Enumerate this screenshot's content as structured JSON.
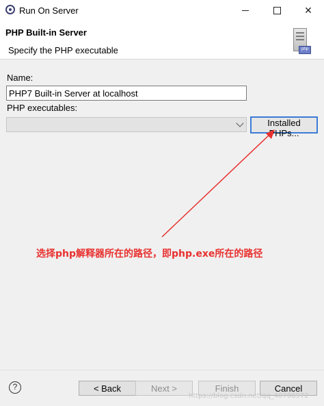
{
  "window": {
    "title": "Run On Server"
  },
  "header": {
    "title": "PHP Built-in Server",
    "subtitle": "Specify the PHP executable",
    "icon_badge": "php"
  },
  "form": {
    "name_label": "Name:",
    "name_value": "PHP7 Built-in Server at localhost",
    "exe_label": "PHP executables:",
    "exe_value": "",
    "installed_button": "Installed PHPs..."
  },
  "annotation": {
    "text": "选择php解释器所在的路径，即php.exe所在的路径",
    "color": "#e8312f"
  },
  "footer": {
    "help": "?",
    "back": "< Back",
    "next": "Next >",
    "finish": "Finish",
    "cancel": "Cancel"
  },
  "watermark": "https://blog.csdn.net/qq_40706972",
  "colors": {
    "focus_border": "#3a7bd5",
    "annotation": "#e8312f",
    "dialog_bg": "#f0f0f0"
  }
}
